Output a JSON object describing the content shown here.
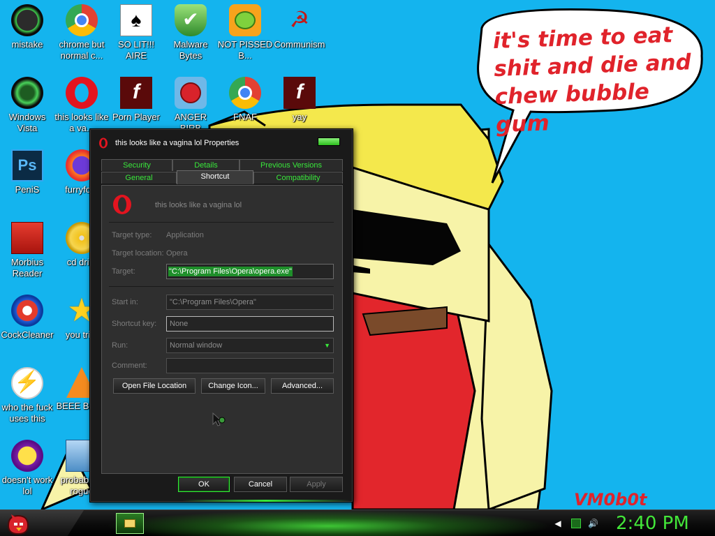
{
  "wallpaper": {
    "speech_text": "it's time to eat shit and die and chew bubble gum",
    "signature": "VM0b0t"
  },
  "desktop_icons": [
    {
      "label": "mistake",
      "icon": "razer-icon"
    },
    {
      "label": "chrome but normal c...",
      "icon": "chrome-icon"
    },
    {
      "label": "SO LIT!!! AIRE",
      "icon": "solitaire-icon"
    },
    {
      "label": "Malware Bytes",
      "icon": "shield-icon"
    },
    {
      "label": "NOT PISSED B...",
      "icon": "bad-piggies-icon"
    },
    {
      "label": "Communism",
      "icon": "communism-icon"
    },
    {
      "label": "Windows Vista",
      "icon": "recycle-bin-icon"
    },
    {
      "label": "this looks like a va...",
      "icon": "opera-icon"
    },
    {
      "label": "Porn Player",
      "icon": "flash-icon"
    },
    {
      "label": "ANGER BIRB",
      "icon": "angry-birds-icon"
    },
    {
      "label": "FNAF",
      "icon": "chrome-icon"
    },
    {
      "label": "yay",
      "icon": "flash-icon"
    },
    {
      "label": "PeniS",
      "icon": "photoshop-icon"
    },
    {
      "label": "furryfo...",
      "icon": "firefox-icon"
    },
    {
      "label": "Morbius Reader",
      "icon": "adobe-reader-icon"
    },
    {
      "label": "cd dri...",
      "icon": "cd-drive-icon"
    },
    {
      "label": "CockCleaner",
      "icon": "ccleaner-icon"
    },
    {
      "label": "you tri...",
      "icon": "star-icon"
    },
    {
      "label": "who the fuck uses this",
      "icon": "lightning-icon"
    },
    {
      "label": "BEEE BEEE",
      "icon": "vlc-icon"
    },
    {
      "label": "doesn't work lol",
      "icon": "yahoo-messenger-icon"
    },
    {
      "label": "probably a rogue",
      "icon": "setup-icon"
    }
  ],
  "dialog": {
    "title": "this looks like a vagina lol Properties",
    "tabs_row1": [
      "Security",
      "Details",
      "Previous Versions"
    ],
    "tabs_row2": [
      "General",
      "Shortcut",
      "Compatibility"
    ],
    "active_tab": "Shortcut",
    "shortcut_name": "this looks like a vagina lol",
    "fields": {
      "target_type_label": "Target type:",
      "target_type_value": "Application",
      "target_location_label": "Target location:",
      "target_location_value": "Opera",
      "target_label": "Target:",
      "target_value": "\"C:\\Program Files\\Opera\\opera.exe\"",
      "start_in_label": "Start in:",
      "start_in_value": "\"C:\\Program Files\\Opera\"",
      "shortcut_key_label": "Shortcut key:",
      "shortcut_key_value": "None",
      "run_label": "Run:",
      "run_value": "Normal window",
      "comment_label": "Comment:",
      "comment_value": ""
    },
    "panel_buttons": {
      "open_file_location": "Open File Location",
      "change_icon": "Change Icon...",
      "advanced": "Advanced..."
    },
    "footer_buttons": {
      "ok": "OK",
      "cancel": "Cancel",
      "apply": "Apply"
    }
  },
  "taskbar": {
    "clock": "2:40 PM"
  },
  "colors": {
    "desktop_background": "#14b4ee",
    "accent_green": "#39e83b",
    "clock_green": "#43e639",
    "speech_red": "#e0232b"
  }
}
